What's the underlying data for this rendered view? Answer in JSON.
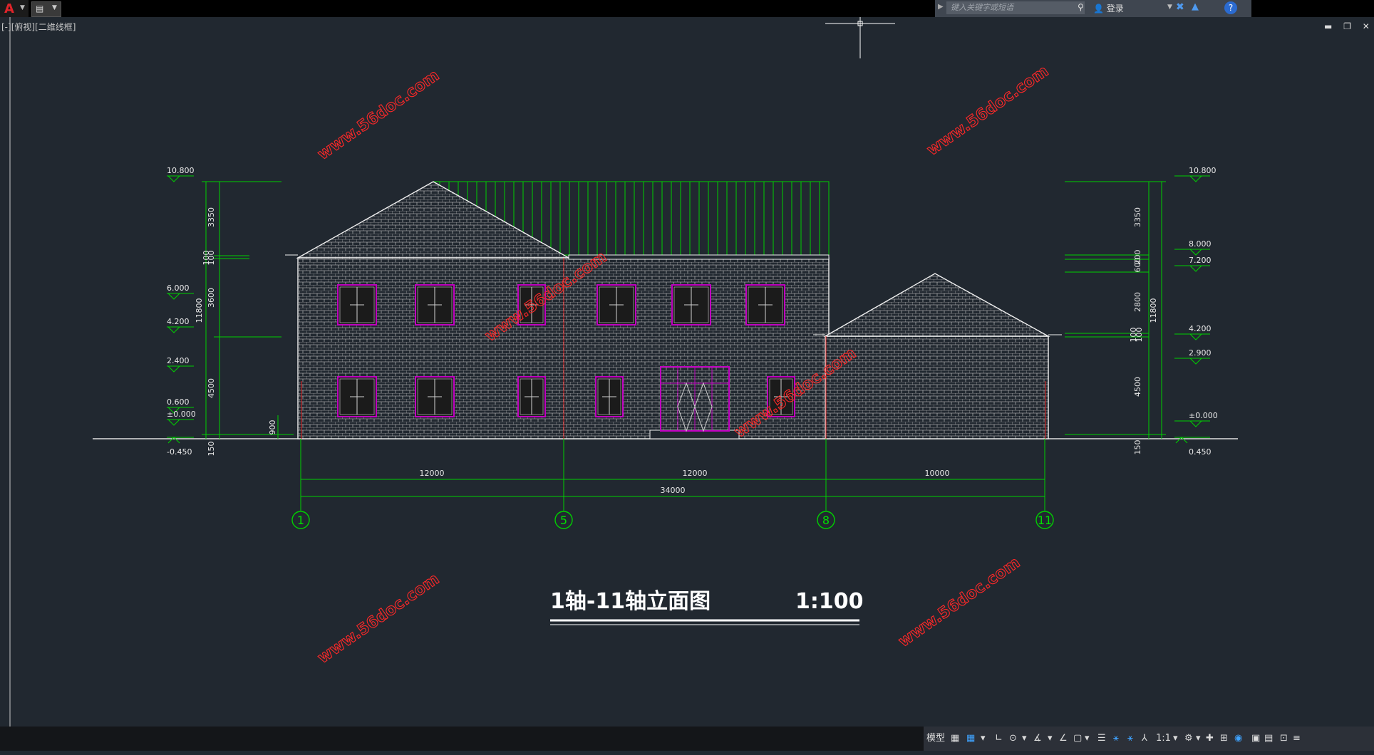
{
  "app": {
    "search_placeholder": "键入关键字或短语",
    "login_label": "登录",
    "viewport_label": "[-][俯视][二维线框]"
  },
  "drawing": {
    "title": "1轴-11轴立面图",
    "scale": "1:100",
    "watermark": "www.56doc.com",
    "left_levels": [
      "10.800",
      "6.000",
      "4.200",
      "2.400",
      "0.600",
      "±0.000",
      "-0.450"
    ],
    "right_levels": [
      "10.800",
      "8.000",
      "7.200",
      "4.200",
      "2.900",
      "±0.000",
      "0.450"
    ],
    "left_dims": [
      "3350",
      "100",
      "100",
      "3600",
      "11800",
      "4500",
      "900",
      "150"
    ],
    "right_dims": [
      "3350",
      "200",
      "600",
      "2800",
      "11800",
      "100",
      "100",
      "4500",
      "150"
    ],
    "bottom_dims": [
      "12000",
      "12000",
      "10000",
      "34000"
    ],
    "axes": [
      "1",
      "5",
      "8",
      "11"
    ]
  },
  "statusbar": {
    "model_label": "模型",
    "scale_label": "1:1"
  },
  "colors": {
    "background": "#212830",
    "dimension": "#00e000",
    "building": "#e6e6e6",
    "window_frame": "#c000c0",
    "watermark": "#ff2020",
    "title": "#ffffff"
  }
}
